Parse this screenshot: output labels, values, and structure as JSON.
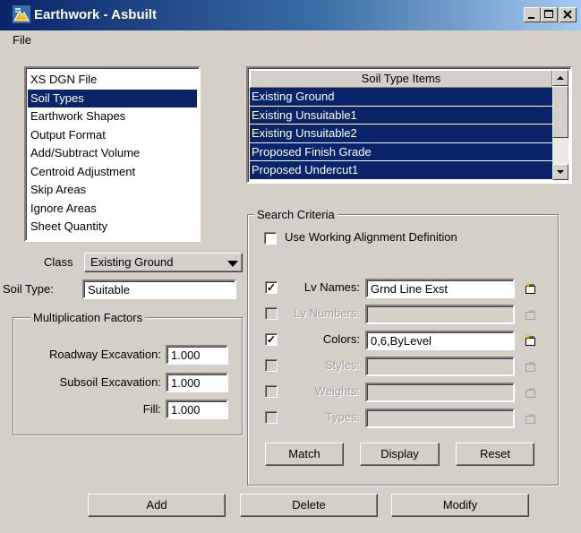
{
  "window": {
    "title": "Earthwork - Asbuilt"
  },
  "menu": {
    "file_label": "File"
  },
  "nav_list": {
    "items": [
      "XS DGN File",
      "Soil Types",
      "Earthwork Shapes",
      "Output Format",
      "Add/Subtract Volume",
      "Centroid Adjustment",
      "Skip Areas",
      "Ignore Areas",
      "Sheet Quantity"
    ],
    "selected_index": 1
  },
  "soil_items": {
    "header": "Soil Type Items",
    "rows": [
      "Existing Ground",
      "Existing Unsuitable1",
      "Existing Unsuitable2",
      "Proposed Finish Grade",
      "Proposed Undercut1"
    ]
  },
  "class_field": {
    "label": "Class",
    "value": "Existing Ground"
  },
  "soil_type": {
    "label": "Soil Type:",
    "value": "Suitable"
  },
  "multiplication": {
    "title": "Multiplication Factors",
    "roadway_label": "Roadway Excavation:",
    "roadway_value": "1.000",
    "subsoil_label": "Subsoil Excavation:",
    "subsoil_value": "1.000",
    "fill_label": "Fill:",
    "fill_value": "1.000"
  },
  "search": {
    "title": "Search Criteria",
    "use_alignment_label": "Use Working Alignment Definition",
    "use_alignment_checked": false,
    "rows": {
      "lv_names": {
        "label": "Lv Names:",
        "value": "Grnd Line Exst",
        "checked": true,
        "enabled": true
      },
      "lv_numbers": {
        "label": "Lv Numbers:",
        "value": "",
        "checked": false,
        "enabled": false
      },
      "colors": {
        "label": "Colors:",
        "value": "0,6,ByLevel",
        "checked": true,
        "enabled": true
      },
      "styles": {
        "label": "Styles:",
        "value": "",
        "checked": false,
        "enabled": false
      },
      "weights": {
        "label": "Weights:",
        "value": "",
        "checked": false,
        "enabled": false
      },
      "types": {
        "label": "Types:",
        "value": "",
        "checked": false,
        "enabled": false
      }
    },
    "match_label": "Match",
    "display_label": "Display",
    "reset_label": "Reset"
  },
  "actions": {
    "add_label": "Add",
    "delete_label": "Delete",
    "modify_label": "Modify"
  },
  "colors": {
    "selection": "#0a246a",
    "title_start": "#0a246a",
    "title_end": "#a6caf0",
    "face": "#d4d0c8"
  },
  "icons": {
    "app": "earthwork-app-icon",
    "pick": "folder-pick-icon"
  }
}
